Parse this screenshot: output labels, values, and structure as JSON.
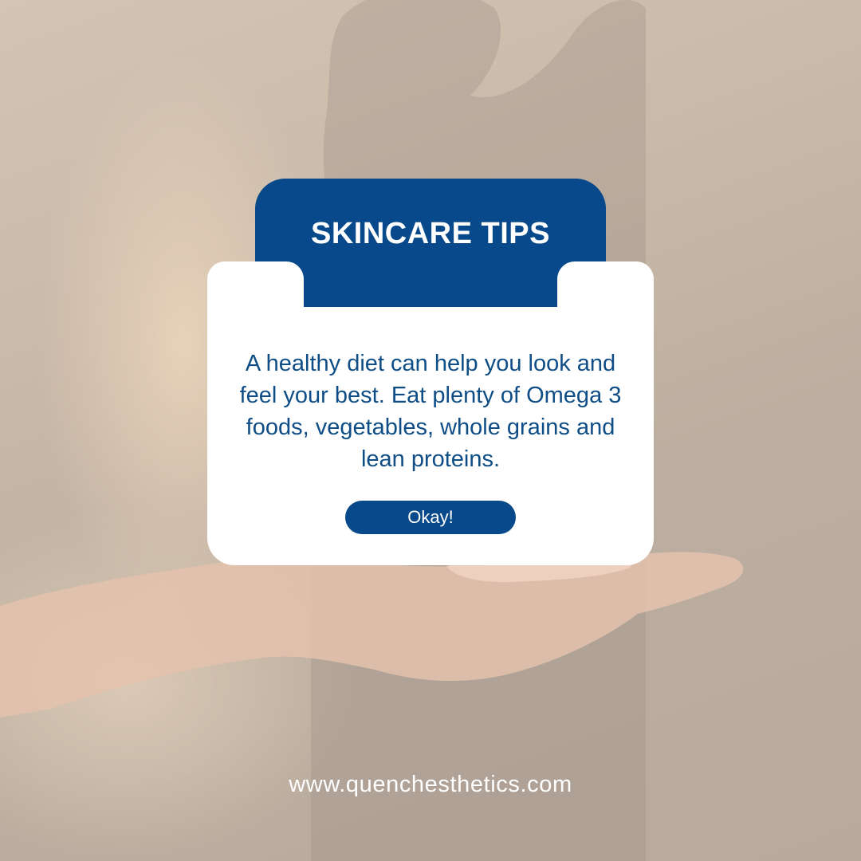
{
  "header": {
    "title": "SKINCARE TIPS"
  },
  "card": {
    "tip": "A healthy diet can help you look and feel your best. Eat plenty of Omega 3 foods, vegetables, whole grains and lean proteins.",
    "button_label": "Okay!"
  },
  "footer": {
    "website": "www.quenchesthetics.com"
  },
  "colors": {
    "brand_blue": "#07498a",
    "text_blue": "#0f4d86",
    "card_background": "#ffffff",
    "footer_text": "#ffffff"
  }
}
